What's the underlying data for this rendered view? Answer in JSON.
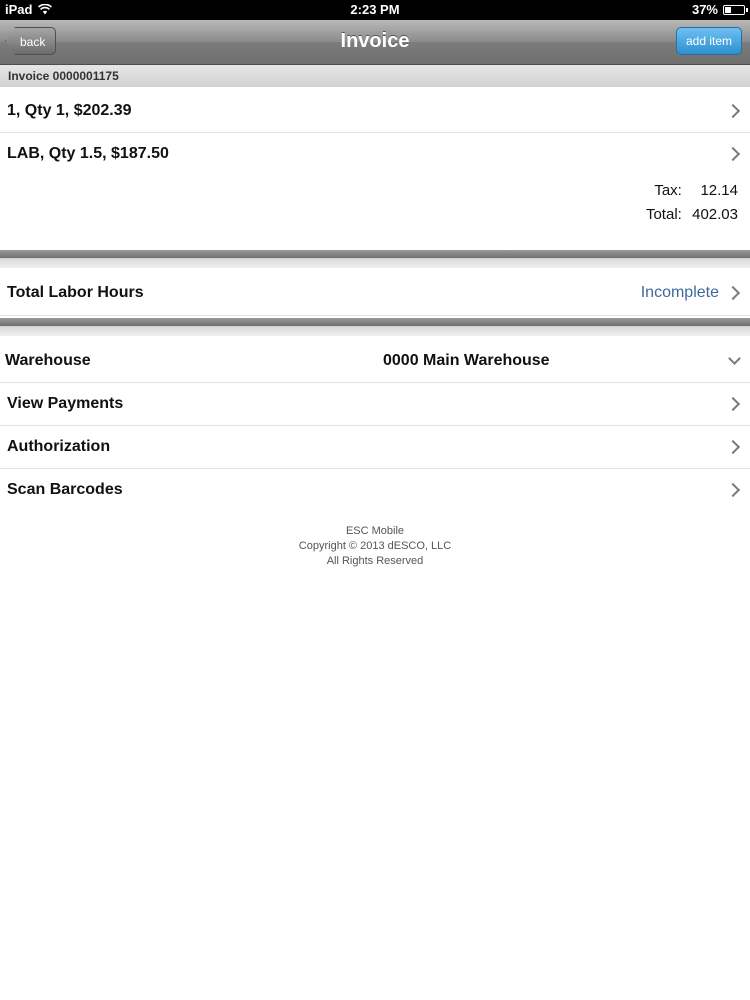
{
  "status_bar": {
    "device": "iPad",
    "time": "2:23 PM",
    "battery": "37%",
    "battery_level": 0.37
  },
  "navbar": {
    "title": "Invoice",
    "back_label": "back",
    "add_label": "add item"
  },
  "invoice": {
    "header": "Invoice 0000001175",
    "items": [
      {
        "label": "1, Qty 1, $202.39"
      },
      {
        "label": "LAB, Qty 1.5, $187.50"
      }
    ],
    "tax_label": "Tax:",
    "tax_value": "12.14",
    "total_label": "Total:",
    "total_value": "402.03"
  },
  "labor": {
    "label": "Total Labor Hours",
    "status": "Incomplete"
  },
  "options": {
    "warehouse_label": "Warehouse",
    "warehouse_value": "0000 Main Warehouse",
    "view_payments": "View Payments",
    "authorization": "Authorization",
    "scan_barcodes": "Scan Barcodes"
  },
  "footer": {
    "line1": "ESC Mobile",
    "line2": "Copyright © 2013 dESCO, LLC",
    "line3": "All Rights Reserved"
  },
  "colors": {
    "link": "#3c6a9e",
    "add_button": "#2d8fd0"
  }
}
